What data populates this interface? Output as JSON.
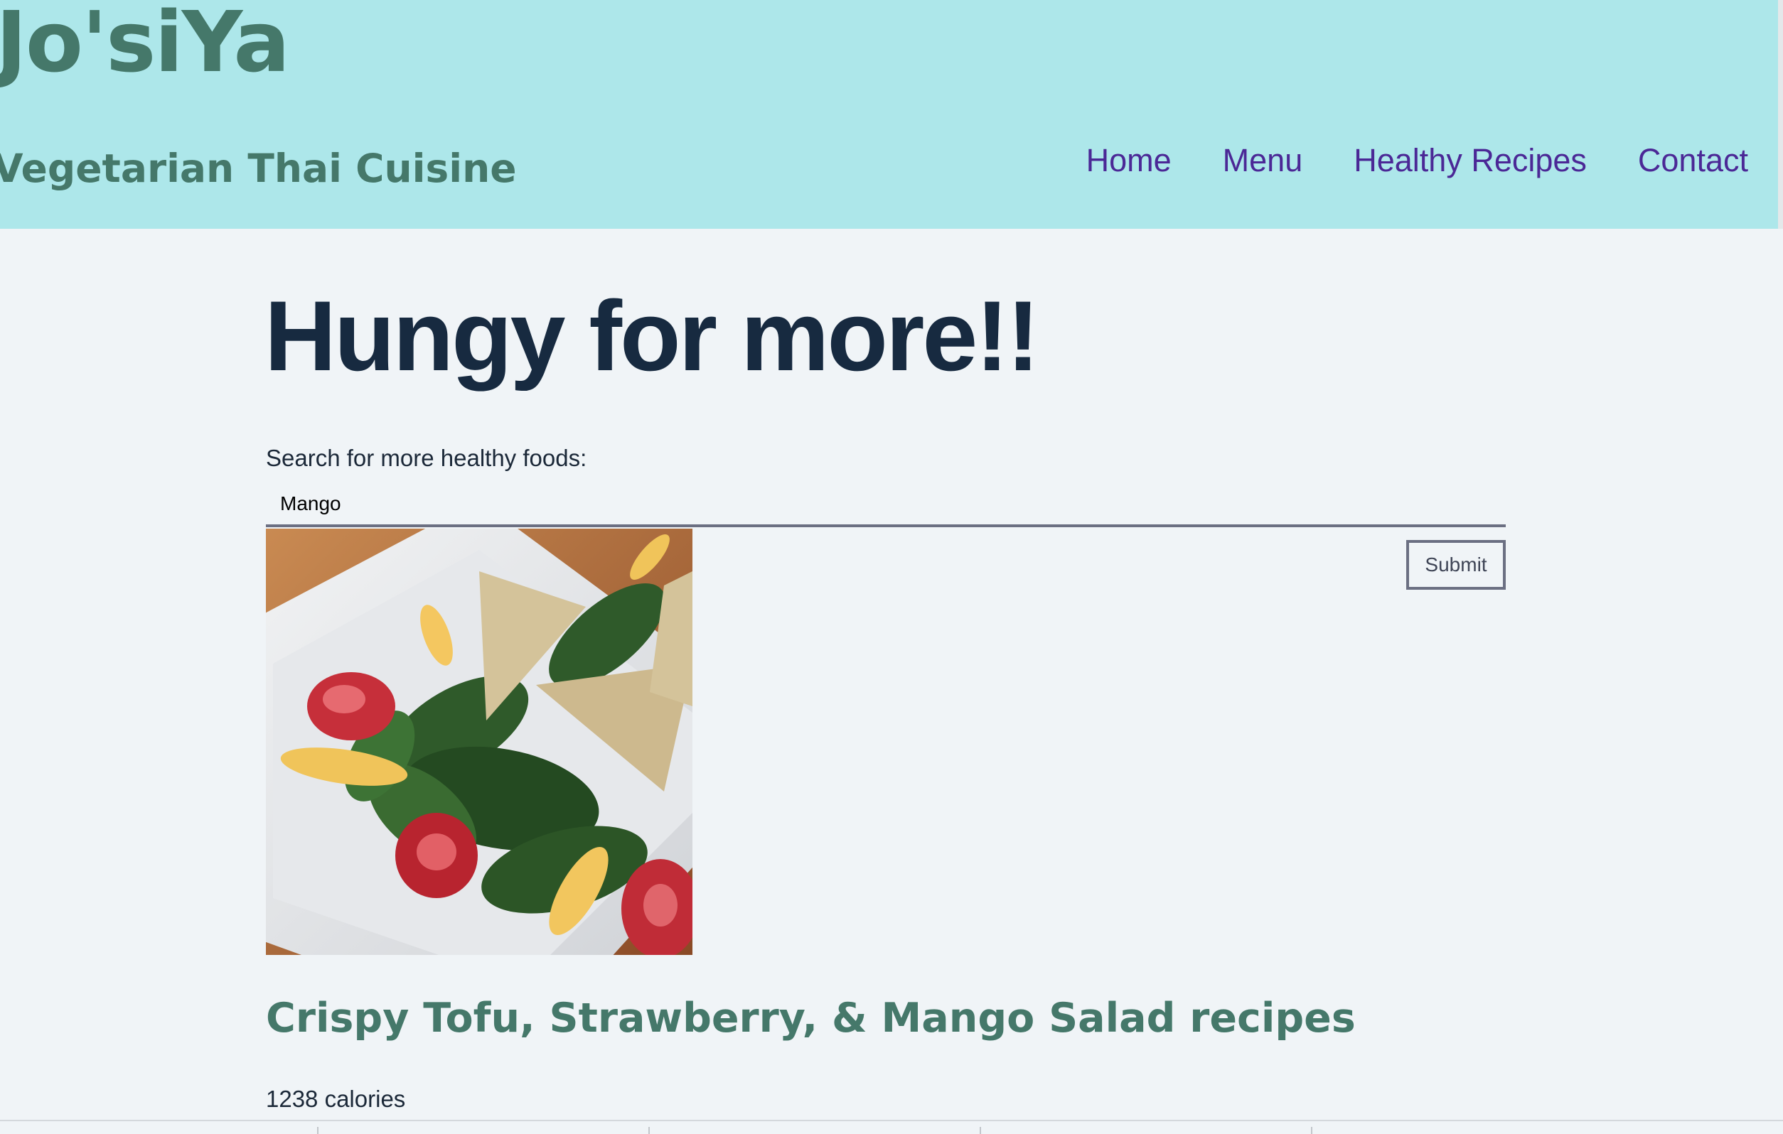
{
  "header": {
    "brand_title": "Jo'siYa",
    "brand_subtitle": "Vegetarian Thai Cuisine",
    "nav": [
      "Home",
      "Menu",
      "Healthy Recipes",
      "Contact"
    ]
  },
  "main": {
    "heading": "Hungy for more!!",
    "search_label": "Search for more healthy foods:",
    "search_value": "Mango",
    "submit_label": "Submit",
    "recipe_title": "Crispy Tofu, Strawberry, & Mango Salad recipes",
    "calories": "1238 calories"
  },
  "colors": {
    "header_bg": "#ade7ea",
    "brand_green": "#45786a",
    "nav_purple": "#4b2896",
    "page_bg": "#f0f4f7",
    "heading_navy": "#172a40"
  }
}
